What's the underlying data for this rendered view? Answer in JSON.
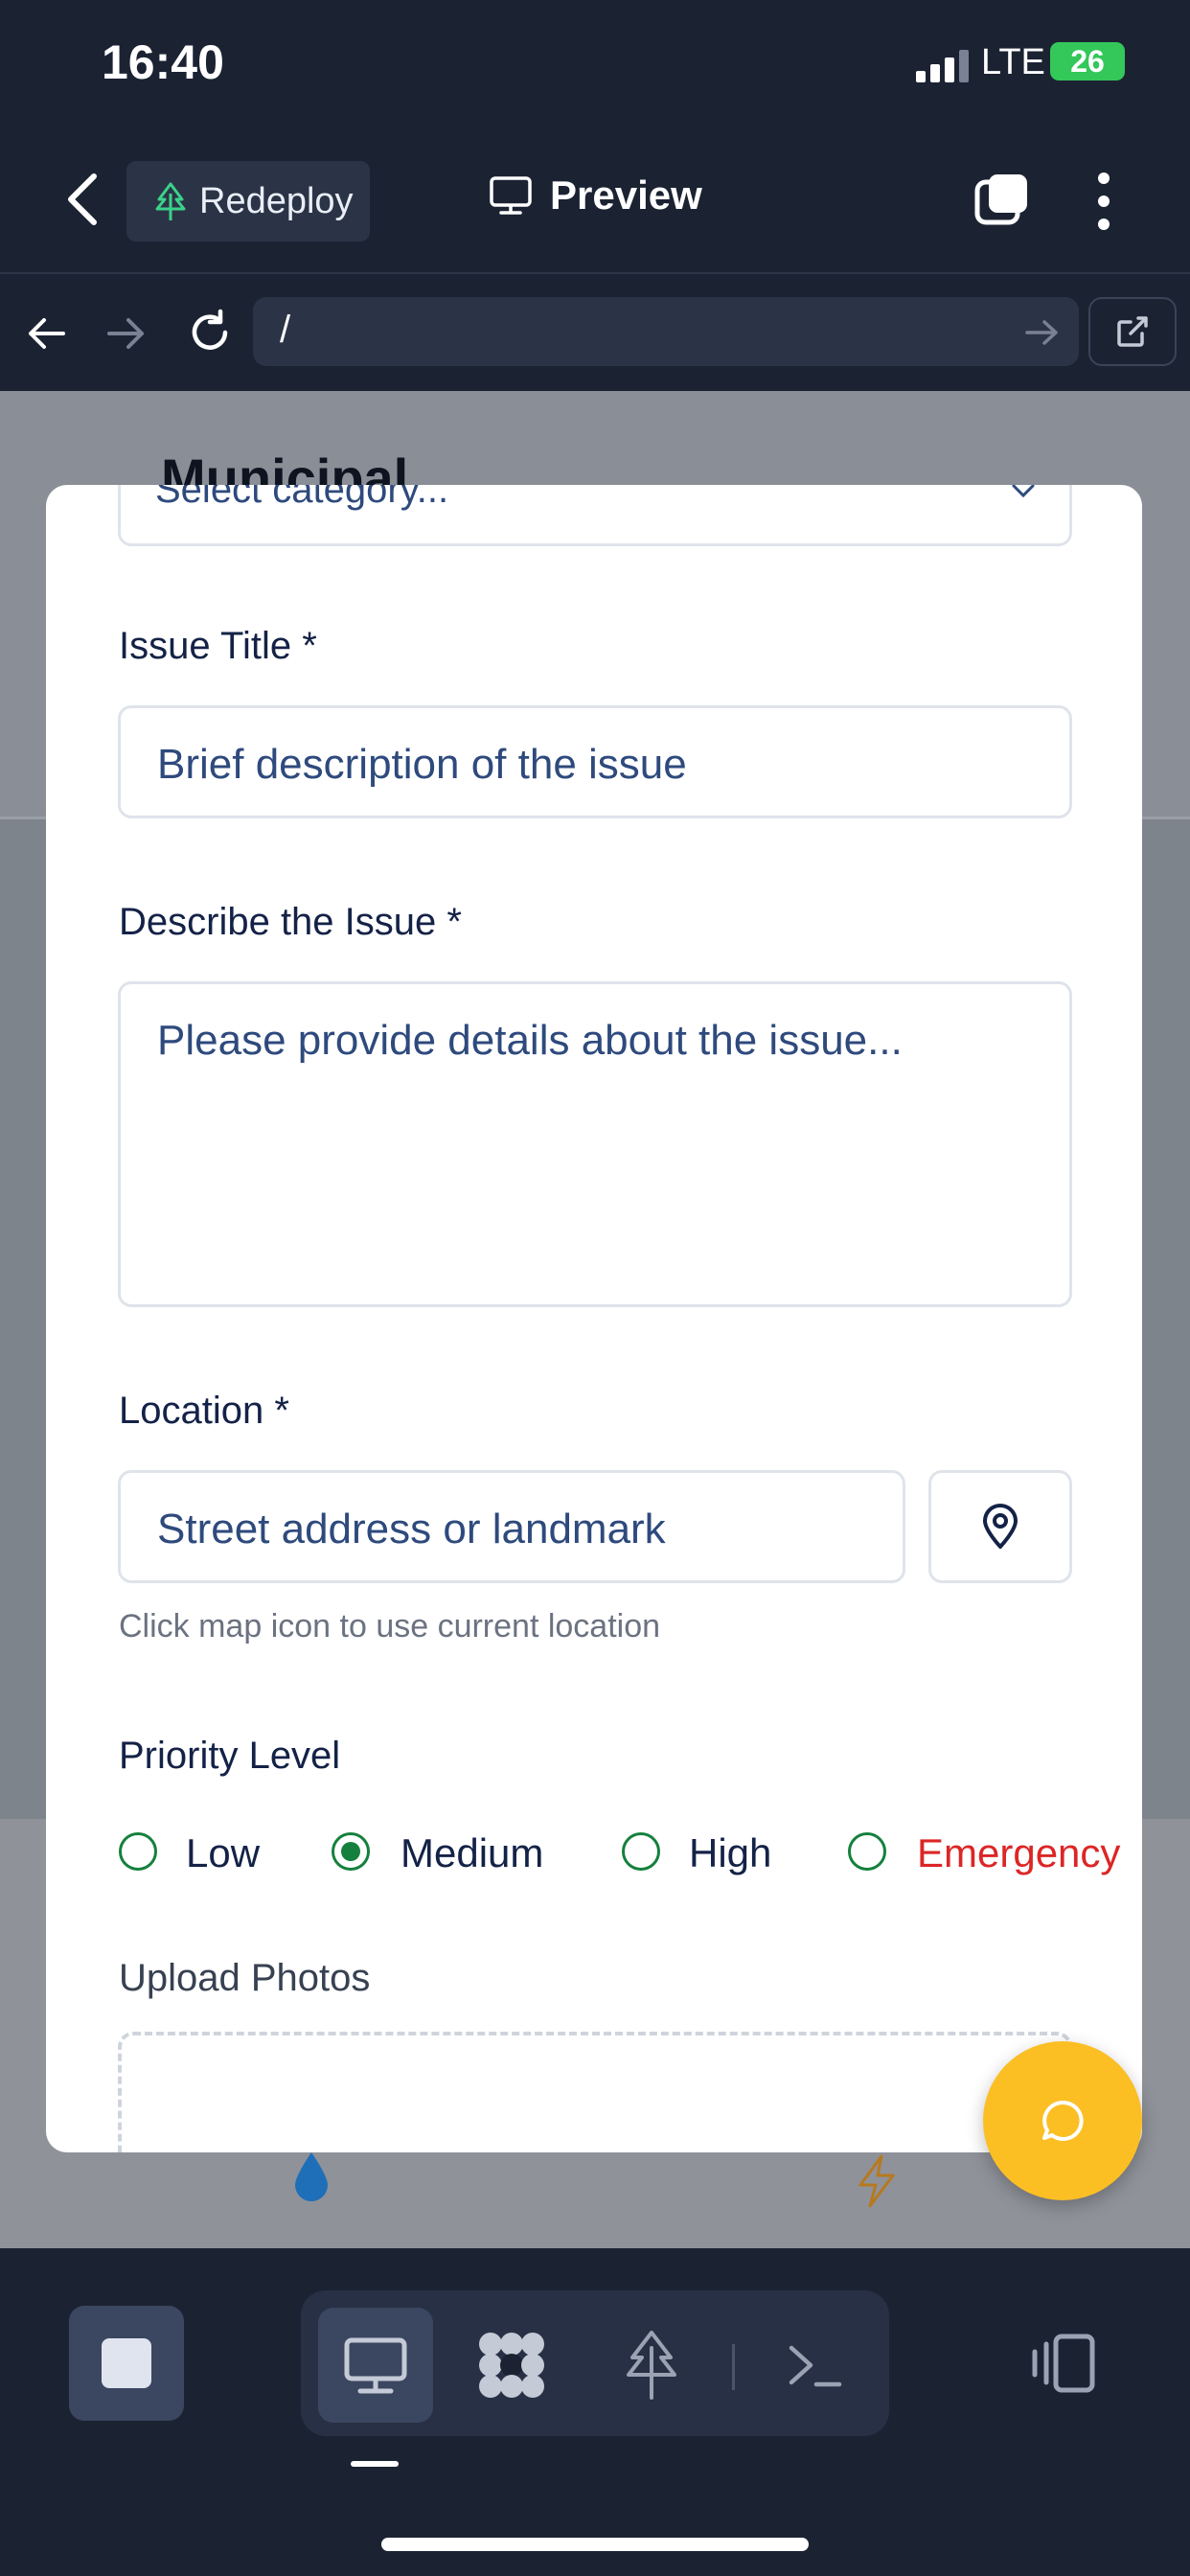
{
  "status": {
    "time": "16:40",
    "network": "LTE",
    "battery": "26"
  },
  "header": {
    "redeploy_label": "Redeploy",
    "preview_label": "Preview"
  },
  "browser": {
    "url": "/"
  },
  "background": {
    "page_title": "Municipal"
  },
  "form": {
    "category_placeholder": "Select category...",
    "title_label": "Issue Title *",
    "title_placeholder": "Brief description of the issue",
    "describe_label": "Describe the Issue *",
    "describe_placeholder": "Please provide details about the issue...",
    "location_label": "Location *",
    "location_placeholder": "Street address or landmark",
    "location_hint": "Click map icon to use current location",
    "priority_label": "Priority Level",
    "priority_options": [
      {
        "label": "Low",
        "selected": false
      },
      {
        "label": "Medium",
        "selected": true
      },
      {
        "label": "High",
        "selected": false
      },
      {
        "label": "Emergency",
        "selected": false
      }
    ],
    "upload_label": "Upload Photos"
  },
  "colors": {
    "app_bg": "#1b2333",
    "accent_green": "#15803d",
    "emergency_red": "#dc2626",
    "fab_yellow": "#fbbf24",
    "label_navy": "#142247"
  }
}
